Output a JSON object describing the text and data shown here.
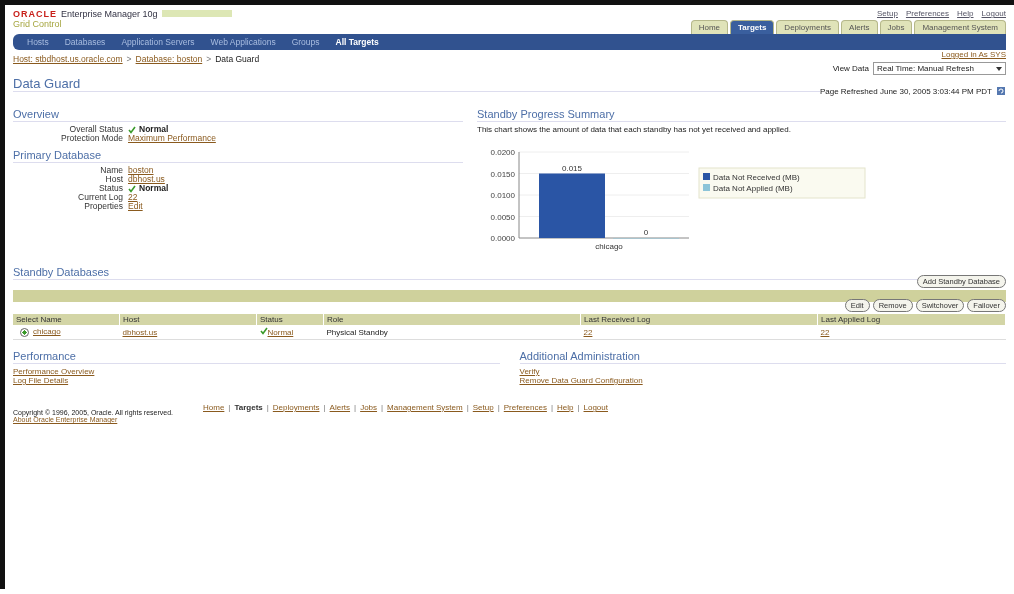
{
  "header": {
    "brand": "ORACLE",
    "product": "Enterprise Manager 10g",
    "subtitle": "Grid Control",
    "global_links": [
      "Setup",
      "Preferences",
      "Help",
      "Logout"
    ],
    "tabs": [
      {
        "label": "Home",
        "selected": false
      },
      {
        "label": "Targets",
        "selected": true
      },
      {
        "label": "Deployments",
        "selected": false
      },
      {
        "label": "Alerts",
        "selected": false
      },
      {
        "label": "Jobs",
        "selected": false
      },
      {
        "label": "Management System",
        "selected": false
      }
    ],
    "subtabs": [
      {
        "label": "Hosts",
        "selected": false
      },
      {
        "label": "Databases",
        "selected": false
      },
      {
        "label": "Application Servers",
        "selected": false
      },
      {
        "label": "Web Applications",
        "selected": false
      },
      {
        "label": "Groups",
        "selected": false
      },
      {
        "label": "All Targets",
        "selected": true
      }
    ]
  },
  "breadcrumb": [
    {
      "label": "Host: stbdhost.us.oracle.com",
      "kind": "link"
    },
    {
      "label": ">",
      "kind": "separator"
    },
    {
      "label": "Database: boston",
      "kind": "link"
    },
    {
      "label": ">",
      "kind": "separator"
    },
    {
      "label": "Data Guard",
      "kind": "current"
    }
  ],
  "page_title": "Data Guard",
  "logged_in": "Logged in As SYS",
  "view_data": {
    "label": "View Data",
    "value": "Real Time: Manual Refresh"
  },
  "refreshed": "Page Refreshed June 30, 2005 3:03:44 PM PDT",
  "overview": {
    "title": "Overview",
    "fields": [
      {
        "label": "Overall Status",
        "value": "Normal",
        "kind": "status"
      },
      {
        "label": "Protection Mode",
        "value": "Maximum Performance",
        "kind": "link"
      }
    ]
  },
  "primary": {
    "title": "Primary Database",
    "fields": [
      {
        "label": "Name",
        "value": "boston",
        "kind": "link"
      },
      {
        "label": "Host",
        "value": "dbhost.us",
        "kind": "link"
      },
      {
        "label": "Status",
        "value": "Normal",
        "kind": "status"
      },
      {
        "label": "Current Log",
        "value": "22",
        "kind": "link"
      },
      {
        "label": "Properties",
        "value": "Edit",
        "kind": "link"
      }
    ]
  },
  "summary": {
    "title": "Standby Progress Summary",
    "description": "This chart shows the amount of data that each standby has not yet received and applied.",
    "chart_data": {
      "type": "bar",
      "grid": true,
      "legend": true,
      "categories": [
        "chicago"
      ],
      "series": [
        {
          "name": "Data Not Received (MB)",
          "color": "#2a55a5",
          "values": [
            0.015
          ]
        },
        {
          "name": "Data Not Applied (MB)",
          "color": "#8cc4d8",
          "values": [
            0
          ]
        }
      ],
      "ylim": [
        0,
        0.02
      ],
      "yticks": [
        {
          "value": 0,
          "label": "0.0000"
        },
        {
          "value": 0.005,
          "label": "0.0050"
        },
        {
          "value": 0.01,
          "label": "0.0100"
        },
        {
          "value": 0.015,
          "label": "0.0150"
        },
        {
          "value": 0.02,
          "label": "0.0200"
        }
      ],
      "value_labels": [
        "0.015",
        "0"
      ]
    }
  },
  "standby": {
    "title": "Standby Databases",
    "add_button": "Add Standby Database",
    "buttons": [
      "Edit",
      "Remove",
      "Switchover",
      "Failover"
    ],
    "columns": [
      "Select Name",
      "Host",
      "Status",
      "Role",
      "Last Received Log",
      "Last Applied Log"
    ],
    "rows": [
      {
        "selected": true,
        "name": "chicago",
        "host": "dbhost.us",
        "status": "Normal",
        "role": "Physical Standby",
        "received": "22",
        "applied": "22"
      }
    ]
  },
  "performance": {
    "title": "Performance",
    "links": [
      "Performance Overview",
      "Log File Details"
    ]
  },
  "administration": {
    "title": "Additional Administration",
    "links": [
      "Verify",
      "Remove Data Guard Configuration"
    ]
  },
  "footer_links": [
    {
      "kind": "link",
      "label": "Home",
      "selected": false
    },
    {
      "kind": "separator",
      "label": "|"
    },
    {
      "kind": "link",
      "label": "Targets",
      "selected": true
    },
    {
      "kind": "separator",
      "label": "|"
    },
    {
      "kind": "link",
      "label": "Deployments",
      "selected": false
    },
    {
      "kind": "separator",
      "label": "|"
    },
    {
      "kind": "link",
      "label": "Alerts",
      "selected": false
    },
    {
      "kind": "separator",
      "label": "|"
    },
    {
      "kind": "link",
      "label": "Jobs",
      "selected": false
    },
    {
      "kind": "separator",
      "label": "|"
    },
    {
      "kind": "link",
      "label": "Management System",
      "selected": false
    },
    {
      "kind": "separator",
      "label": "|"
    },
    {
      "kind": "link",
      "label": "Setup",
      "selected": false
    },
    {
      "kind": "separator",
      "label": "|"
    },
    {
      "kind": "link",
      "label": "Preferences",
      "selected": false
    },
    {
      "kind": "separator",
      "label": "|"
    },
    {
      "kind": "link",
      "label": "Help",
      "selected": false
    },
    {
      "kind": "separator",
      "label": "|"
    },
    {
      "kind": "link",
      "label": "Logout",
      "selected": false
    }
  ],
  "copyright": "Copyright © 1996, 2005, Oracle. All rights reserved.",
  "about": "About Oracle Enterprise Manager"
}
